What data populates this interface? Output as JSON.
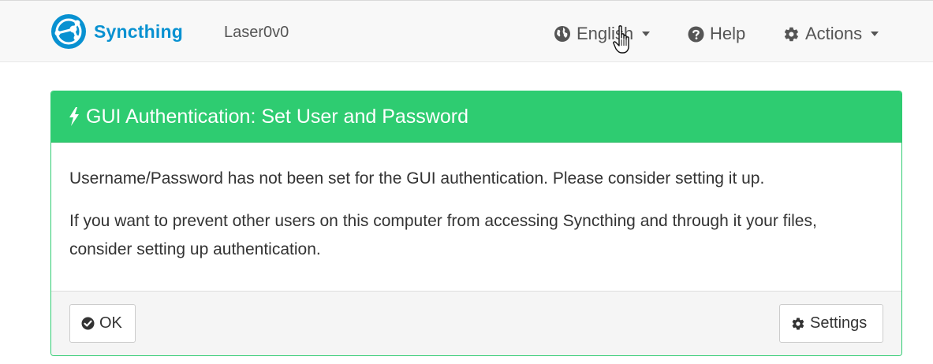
{
  "navbar": {
    "brand": {
      "name": "Syncthing",
      "logo_icon": "syncthing-logo-icon"
    },
    "device_name": "Laser0v0",
    "language": {
      "label": "English",
      "icon": "globe-icon"
    },
    "help": {
      "label": "Help",
      "icon": "question-circle-icon"
    },
    "actions": {
      "label": "Actions",
      "icon": "gear-icon"
    }
  },
  "notice": {
    "title": "GUI Authentication: Set User and Password",
    "title_icon": "bolt-icon",
    "paragraphs": [
      "Username/Password has not been set for the GUI authentication. Please consider setting it up.",
      "If you want to prevent other users on this computer from accessing Syncthing and through it your files, consider setting up authentication."
    ],
    "ok_button": {
      "label": "OK",
      "icon": "check-circle-icon"
    },
    "settings_button": {
      "label": "Settings",
      "icon": "gear-icon"
    }
  },
  "colors": {
    "brand": "#0891d1",
    "panel_success": "#2ecc71",
    "navbar_bg": "#f8f8f8"
  }
}
